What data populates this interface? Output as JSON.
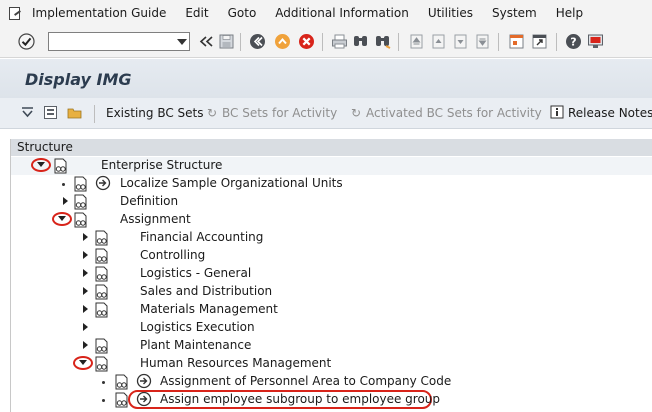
{
  "menubar": {
    "icon": "exit-menu-icon",
    "items": [
      "Implementation Guide",
      "Edit",
      "Goto",
      "Additional Information",
      "Utilities",
      "System",
      "Help"
    ]
  },
  "toolbar": {
    "command_value": "",
    "icons": [
      "check-icon",
      "command-dropdown-icon",
      "double-chevron-left-icon",
      "save-icon",
      "back-icon",
      "exit-icon",
      "cancel-icon",
      "print-icon",
      "find-icon",
      "find-next-icon",
      "first-page-icon",
      "previous-page-icon",
      "next-page-icon",
      "last-page-icon",
      "new-session-icon",
      "shortcut-icon",
      "help-icon",
      "customize-layout-icon"
    ]
  },
  "title": "Display IMG",
  "app_toolbar": {
    "existing_bc_sets": "Existing BC Sets",
    "bc_sets_for_activity": "BC Sets for Activity",
    "activated_bc_sets": "Activated BC Sets for Activity",
    "release_notes": "Release Notes"
  },
  "structure": {
    "header": "Structure",
    "rows": [
      {
        "label": "Enterprise Structure"
      },
      {
        "label": "Localize Sample Organizational Units"
      },
      {
        "label": "Definition"
      },
      {
        "label": "Assignment"
      },
      {
        "label": "Financial Accounting"
      },
      {
        "label": "Controlling"
      },
      {
        "label": "Logistics - General"
      },
      {
        "label": "Sales and Distribution"
      },
      {
        "label": "Materials Management"
      },
      {
        "label": "Logistics Execution"
      },
      {
        "label": "Plant Maintenance"
      },
      {
        "label": "Human Resources Management"
      },
      {
        "label": "Assignment of Personnel Area to Company Code"
      },
      {
        "label": "Assign employee subgroup to employee group"
      }
    ]
  },
  "colors": {
    "highlight_ring": "#d8241a",
    "title": "#2c3c4f",
    "disabled_text": "#8f8f8f"
  }
}
